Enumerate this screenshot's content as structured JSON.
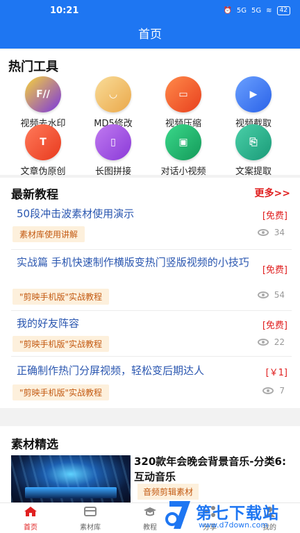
{
  "status_bar": {
    "time": "10:21",
    "battery": "42",
    "signal": "5G",
    "signal2": "5G"
  },
  "header": {
    "title": "首页"
  },
  "tools": {
    "title": "热门工具",
    "items": [
      {
        "label": "视频去水印",
        "icon": "watermark-remove-icon",
        "glyph": "F//",
        "color": "#7a35e0"
      },
      {
        "label": "MD5修改",
        "icon": "md5-face-icon",
        "glyph": "◡",
        "color": "#f3c46a"
      },
      {
        "label": "视频压缩",
        "icon": "compress-icon",
        "glyph": "▭",
        "color": "#f0552a"
      },
      {
        "label": "视频截取",
        "icon": "video-clip-icon",
        "glyph": "▶",
        "color": "#3a7af0"
      },
      {
        "label": "文章伪原创",
        "icon": "article-icon",
        "glyph": "T",
        "color": "#f0452a"
      },
      {
        "label": "长图拼接",
        "icon": "book-icon",
        "glyph": "▯",
        "color": "#a04ae0"
      },
      {
        "label": "对话小视频",
        "icon": "chat-video-icon",
        "glyph": "▣",
        "color": "#1faa6a"
      },
      {
        "label": "文案提取",
        "icon": "text-extract-icon",
        "glyph": "⎘",
        "color": "#25b08a"
      }
    ]
  },
  "tutorials": {
    "title": "最新教程",
    "more": "更多>>",
    "items": [
      {
        "title": "50段冲击波素材使用演示",
        "price": "[免费]",
        "tag": "素材库使用讲解",
        "views": "34"
      },
      {
        "title": "实战篇 手机快速制作横版变热门竖版视频的小技巧",
        "price": "[免费]",
        "tag": "\"剪映手机版\"实战教程",
        "views": "54"
      },
      {
        "title": "我的好友阵容",
        "price": "[免费]",
        "tag": "\"剪映手机版\"实战教程",
        "views": "22"
      },
      {
        "title": "正确制作热门分屏视频，轻松变后期达人",
        "price": "[￥1]",
        "tag": "\"剪映手机版\"实战教程",
        "views": "7"
      }
    ]
  },
  "materials": {
    "title": "素材精选",
    "item_title": "320款年会晚会背景音乐-分类6: 互动音乐",
    "item_tag": "音频剪辑素材"
  },
  "tabbar": {
    "tabs": [
      {
        "label": "首页",
        "icon": "home-icon",
        "active": true
      },
      {
        "label": "素材库",
        "icon": "library-icon",
        "active": false
      },
      {
        "label": "教程",
        "icon": "tutorial-icon",
        "active": false
      },
      {
        "label": "分享",
        "icon": "share-icon",
        "active": false
      },
      {
        "label": "我的",
        "icon": "profile-icon",
        "active": false
      }
    ]
  },
  "watermark": {
    "brand": "第七下载站",
    "url": "www.d7down.com"
  }
}
